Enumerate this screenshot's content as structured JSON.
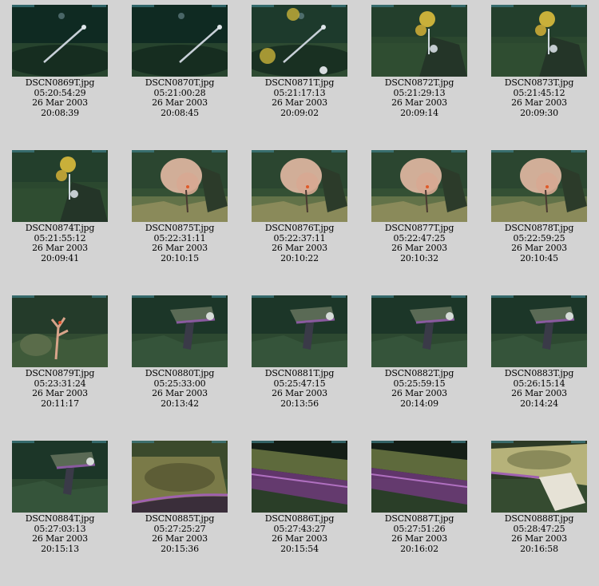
{
  "thumbnails": [
    {
      "filename": "DSCN0869T.jpg",
      "timecode": "05:20:54:29",
      "date": "26 Mar 2003",
      "time": "20:08:39",
      "scene": "fish-dark"
    },
    {
      "filename": "DSCN0870T.jpg",
      "timecode": "05:21:00:28",
      "date": "26 Mar 2003",
      "time": "20:08:45",
      "scene": "fish-dark"
    },
    {
      "filename": "DSCN0871T.jpg",
      "timecode": "05:21:17:13",
      "date": "26 Mar 2003",
      "time": "20:09:02",
      "scene": "fish-coral"
    },
    {
      "filename": "DSCN0872T.jpg",
      "timecode": "05:21:29:13",
      "date": "26 Mar 2003",
      "time": "20:09:14",
      "scene": "yellow-coral"
    },
    {
      "filename": "DSCN0873T.jpg",
      "timecode": "05:21:45:12",
      "date": "26 Mar 2003",
      "time": "20:09:30",
      "scene": "yellow-coral"
    },
    {
      "filename": "DSCN0874T.jpg",
      "timecode": "05:21:55:12",
      "date": "26 Mar 2003",
      "time": "20:09:41",
      "scene": "yellow-coral"
    },
    {
      "filename": "DSCN0875T.jpg",
      "timecode": "05:22:31:11",
      "date": "26 Mar 2003",
      "time": "20:10:15",
      "scene": "pink-coral"
    },
    {
      "filename": "DSCN0876T.jpg",
      "timecode": "05:22:37:11",
      "date": "26 Mar 2003",
      "time": "20:10:22",
      "scene": "pink-coral"
    },
    {
      "filename": "DSCN0877T.jpg",
      "timecode": "05:22:47:25",
      "date": "26 Mar 2003",
      "time": "20:10:32",
      "scene": "pink-coral"
    },
    {
      "filename": "DSCN0878T.jpg",
      "timecode": "05:22:59:25",
      "date": "26 Mar 2003",
      "time": "20:10:45",
      "scene": "pink-coral"
    },
    {
      "filename": "DSCN0879T.jpg",
      "timecode": "05:23:31:24",
      "date": "26 Mar 2003",
      "time": "20:11:17",
      "scene": "red-sprig"
    },
    {
      "filename": "DSCN0880T.jpg",
      "timecode": "05:25:33:00",
      "date": "26 Mar 2003",
      "time": "20:13:42",
      "scene": "rock-ledge"
    },
    {
      "filename": "DSCN0881T.jpg",
      "timecode": "05:25:47:15",
      "date": "26 Mar 2003",
      "time": "20:13:56",
      "scene": "rock-ledge"
    },
    {
      "filename": "DSCN0882T.jpg",
      "timecode": "05:25:59:15",
      "date": "26 Mar 2003",
      "time": "20:14:09",
      "scene": "rock-ledge"
    },
    {
      "filename": "DSCN0883T.jpg",
      "timecode": "05:26:15:14",
      "date": "26 Mar 2003",
      "time": "20:14:24",
      "scene": "rock-ledge"
    },
    {
      "filename": "DSCN0884T.jpg",
      "timecode": "05:27:03:13",
      "date": "26 Mar 2003",
      "time": "20:15:13",
      "scene": "rock-ledge"
    },
    {
      "filename": "DSCN0885T.jpg",
      "timecode": "05:27:25:27",
      "date": "26 Mar 2003",
      "time": "20:15:36",
      "scene": "ledge-close"
    },
    {
      "filename": "DSCN0886T.jpg",
      "timecode": "05:27:43:27",
      "date": "26 Mar 2003",
      "time": "20:15:54",
      "scene": "purple-ledge"
    },
    {
      "filename": "DSCN0887T.jpg",
      "timecode": "05:27:51:26",
      "date": "26 Mar 2003",
      "time": "20:16:02",
      "scene": "purple-ledge"
    },
    {
      "filename": "DSCN0888T.jpg",
      "timecode": "05:28:47:25",
      "date": "26 Mar 2003",
      "time": "20:16:58",
      "scene": "sponge-top"
    }
  ]
}
